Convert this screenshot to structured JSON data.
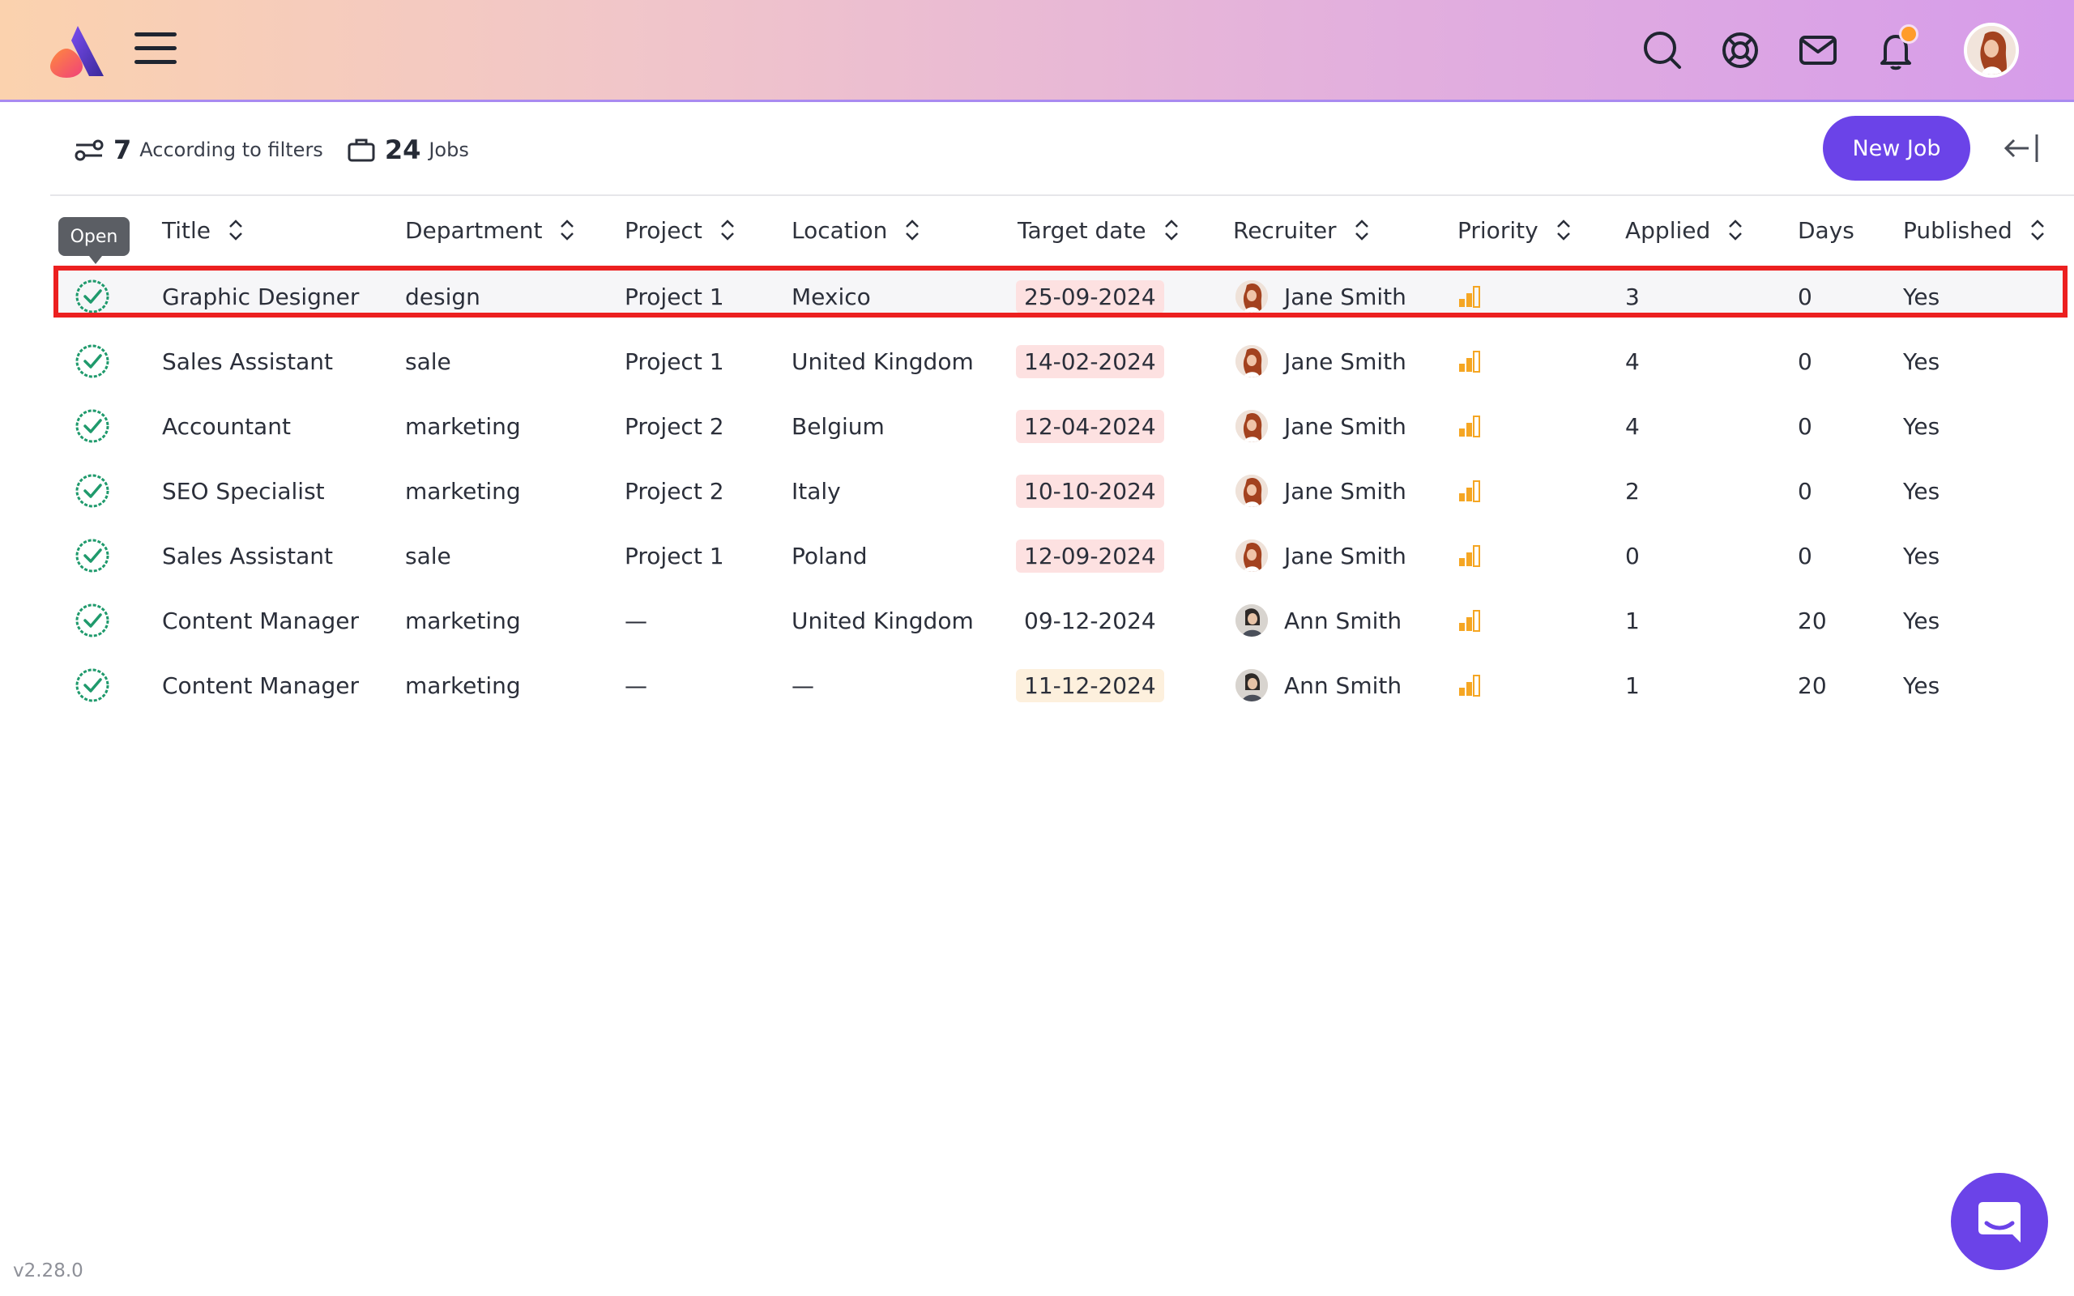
{
  "header": {
    "icons": [
      "logo-icon",
      "hamburger-menu-icon",
      "search-icon",
      "help-lifebuoy-icon",
      "mail-icon",
      "bell-icon",
      "profile-avatar"
    ],
    "notification_dot_color": "#ff9c2a"
  },
  "toolbar": {
    "filters_count": "7",
    "filters_label": "According to filters",
    "jobs_count": "24",
    "jobs_label": "Jobs",
    "new_job_label": "New Job"
  },
  "tooltip": "Open",
  "table": {
    "columns": [
      "Title",
      "Department",
      "Project",
      "Location",
      "Target date",
      "Recruiter",
      "Priority",
      "Applied",
      "Days",
      "Published"
    ],
    "rows": [
      {
        "title": "Graphic Designer",
        "department": "design",
        "project": "Project 1",
        "location": "Mexico",
        "target_date": "25-09-2024",
        "date_style": "red",
        "recruiter": "Jane Smith",
        "applied": "3",
        "days": "0",
        "published": "Yes"
      },
      {
        "title": "Sales Assistant",
        "department": "sale",
        "project": "Project 1",
        "location": "United Kingdom",
        "target_date": "14-02-2024",
        "date_style": "red",
        "recruiter": "Jane Smith",
        "applied": "4",
        "days": "0",
        "published": "Yes"
      },
      {
        "title": "Accountant",
        "department": "marketing",
        "project": "Project 2",
        "location": "Belgium",
        "target_date": "12-04-2024",
        "date_style": "red",
        "recruiter": "Jane Smith",
        "applied": "4",
        "days": "0",
        "published": "Yes"
      },
      {
        "title": "SEO Specialist",
        "department": "marketing",
        "project": "Project 2",
        "location": "Italy",
        "target_date": "10-10-2024",
        "date_style": "red",
        "recruiter": "Jane Smith",
        "applied": "2",
        "days": "0",
        "published": "Yes"
      },
      {
        "title": "Sales Assistant",
        "department": "sale",
        "project": "Project 1",
        "location": "Poland",
        "target_date": "12-09-2024",
        "date_style": "red",
        "recruiter": "Jane Smith",
        "applied": "0",
        "days": "0",
        "published": "Yes"
      },
      {
        "title": "Content Manager",
        "department": "marketing",
        "project": "—",
        "location": "United Kingdom",
        "target_date": "09-12-2024",
        "date_style": "none",
        "recruiter": "Ann Smith",
        "applied": "1",
        "days": "20",
        "published": "Yes"
      },
      {
        "title": "Content Manager",
        "department": "marketing",
        "project": "—",
        "location": "—",
        "target_date": "11-12-2024",
        "date_style": "amber",
        "recruiter": "Ann Smith",
        "applied": "1",
        "days": "20",
        "published": "Yes"
      }
    ]
  },
  "colors": {
    "accent": "#6b43e8",
    "status_green": "#1f9a6c",
    "priority_orange": "#f5a623",
    "highlight_red": "#ec2020"
  },
  "version": "v2.28.0"
}
